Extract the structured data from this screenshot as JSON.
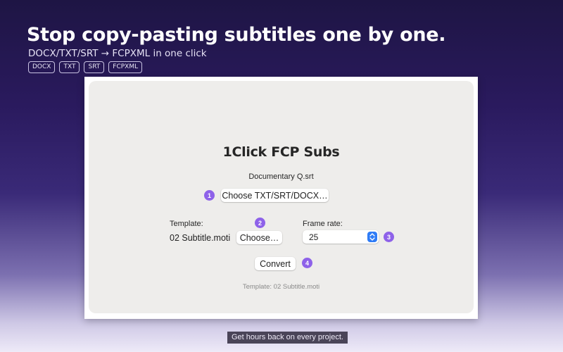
{
  "hero": {
    "title": "Stop copy-pasting subtitles one by one.",
    "subtitle": "DOCX/TXT/SRT → FCPXML in one click",
    "tags": [
      "DOCX",
      "TXT",
      "SRT",
      "FCPXML"
    ]
  },
  "app": {
    "title": "1Click FCP Subs",
    "file_name": "Documentary Q.srt",
    "choose_file_button": "Choose TXT/SRT/DOCX…",
    "template_label": "Template:",
    "template_value": "02 Subtitle.moti",
    "choose_template_button": "Choose…",
    "frame_rate_label": "Frame rate:",
    "frame_rate_value": "25",
    "convert_button": "Convert",
    "status_text": "Template: 02 Subtitle.moti",
    "steps": [
      "1",
      "2",
      "3",
      "4"
    ],
    "accent_color": "#8e62e9",
    "select_arrow_color": "#2f7cf6"
  },
  "caption": "Get hours back on every project."
}
